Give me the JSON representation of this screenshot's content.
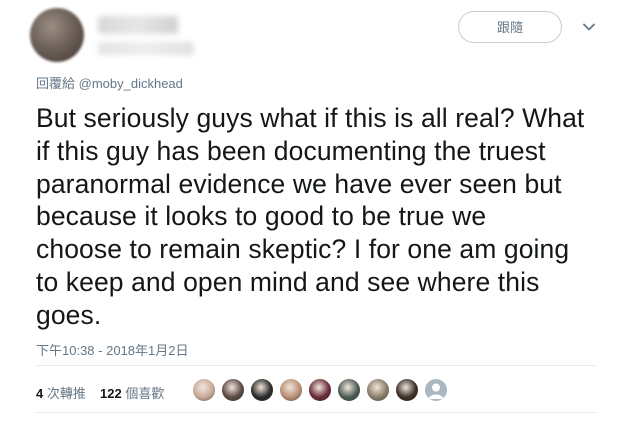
{
  "header": {
    "follow_label": "跟隨",
    "more_icon": "chevron-down-icon"
  },
  "reply": {
    "prefix": "回覆給",
    "handle": "@moby_dickhead"
  },
  "tweet": {
    "lines": [
      "But seriously guys what if this is all real? What",
      "if this guy has been documenting the truest",
      "paranormal evidence we have ever seen but",
      "because it looks to good to be true we",
      "choose to remain skeptic? I for one am going",
      "to keep and open mind and see where this",
      "goes."
    ]
  },
  "timestamp": "下午10:38 - 2018年1月2日",
  "stats": {
    "retweets_count": "4",
    "retweets_label": "次轉推",
    "likes_count": "122",
    "likes_label": "個喜歡"
  },
  "likers": [
    {
      "name": "liker-1",
      "color": "#c9a99a"
    },
    {
      "name": "liker-2",
      "color": "#5b4a44"
    },
    {
      "name": "liker-3",
      "color": "#2a2a2a"
    },
    {
      "name": "liker-4",
      "color": "#b88f74"
    },
    {
      "name": "liker-5",
      "color": "#6a2b3a"
    },
    {
      "name": "liker-6",
      "color": "#4d5b55"
    },
    {
      "name": "liker-7",
      "color": "#8a7d6a"
    },
    {
      "name": "liker-8",
      "color": "#3b3028"
    },
    {
      "name": "liker-9",
      "color": "#aab8c2"
    }
  ]
}
